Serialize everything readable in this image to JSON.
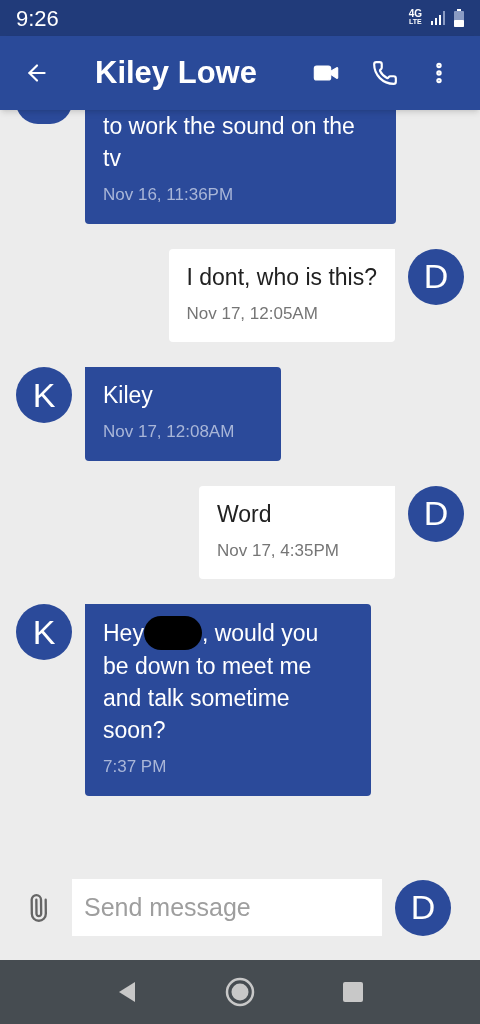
{
  "status_bar": {
    "time": "9:26",
    "network_top": "4G",
    "network_bottom": "LTE"
  },
  "header": {
    "title": "Kiley Lowe"
  },
  "messages": [
    {
      "kind": "incoming",
      "text": "to work the sound on the tv",
      "time": "Nov 16, 11:36PM"
    },
    {
      "kind": "outgoing",
      "avatar": "D",
      "text": "I dont, who is this?",
      "time": "Nov 17, 12:05AM"
    },
    {
      "kind": "incoming",
      "avatar": "K",
      "text": "Kiley",
      "time": "Nov 17, 12:08AM"
    },
    {
      "kind": "outgoing",
      "avatar": "D",
      "text": "Word",
      "time": "Nov 17, 4:35PM"
    },
    {
      "kind": "incoming",
      "avatar": "K",
      "text": "Hey",
      "redaction": true,
      "text_after_redaction": ", would you",
      "text_next_lines": "be down to meet me and talk sometime soon?",
      "time": "7:37 PM"
    }
  ],
  "composer": {
    "placeholder": "Send message",
    "avatar": "D"
  }
}
